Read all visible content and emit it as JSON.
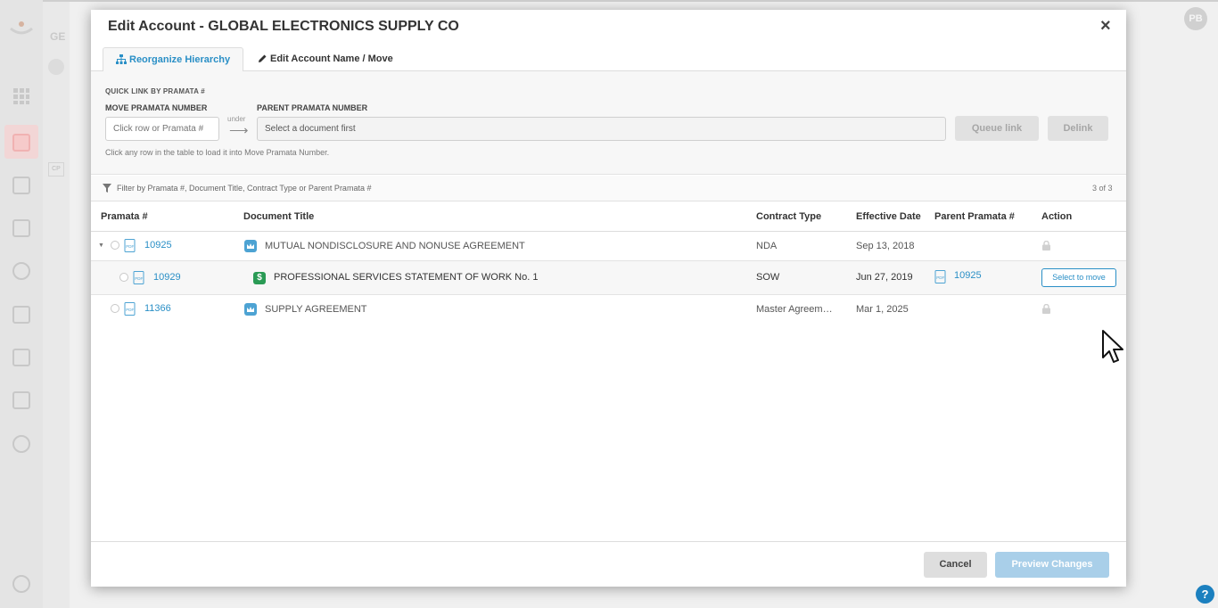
{
  "background": {
    "section_code": "GE",
    "cp_label": "CP",
    "avatar_initials": "PB",
    "help_label": "?"
  },
  "modal": {
    "title": "Edit Account - GLOBAL ELECTRONICS SUPPLY CO",
    "tabs": [
      {
        "label": "Reorganize Hierarchy",
        "icon": "sitemap-icon",
        "active": true
      },
      {
        "label": "Edit Account Name / Move",
        "icon": "pencil-icon",
        "active": false
      }
    ],
    "quick_link": {
      "title": "QUICK LINK BY PRAMATA #",
      "move_label": "MOVE PRAMATA NUMBER",
      "move_placeholder": "Click row or Pramata #",
      "under_label": "under",
      "parent_label": "PARENT PRAMATA NUMBER",
      "parent_placeholder": "Select a document first",
      "queue_label": "Queue link",
      "delink_label": "Delink",
      "hint": "Click any row in the table to load it into Move Pramata Number."
    },
    "filter": {
      "placeholder": "Filter by Pramata #, Document Title, Contract Type or Parent Pramata #",
      "count": "3 of 3"
    },
    "table": {
      "headers": [
        "Pramata #",
        "Document Title",
        "Contract Type",
        "Effective Date",
        "Parent Pramata #",
        "Action"
      ],
      "rows": [
        {
          "pramata": "10925",
          "title": "MUTUAL NONDISCLOSURE AND NONUSE AGREEMENT",
          "type_icon": "crown-icon",
          "contract_type": "NDA",
          "effective_date": "Sep 13, 2018",
          "parent": "",
          "action": "lock"
        },
        {
          "pramata": "10929",
          "title": "PROFESSIONAL SERVICES STATEMENT OF WORK No. 1",
          "type_icon": "dollar-icon",
          "contract_type": "SOW",
          "effective_date": "Jun 27, 2019",
          "parent": "10925",
          "action": "Select to move"
        },
        {
          "pramata": "11366",
          "title": "SUPPLY AGREEMENT",
          "type_icon": "crown-icon",
          "contract_type": "Master Agreem…",
          "effective_date": "Mar 1, 2025",
          "parent": "",
          "action": "lock"
        }
      ]
    },
    "footer": {
      "cancel_label": "Cancel",
      "preview_label": "Preview Changes"
    }
  },
  "colors": {
    "accent": "#2a8fc6",
    "preview_disabled": "#a9cfe9",
    "dollar_badge": "#2a9b55",
    "crown_badge": "#4da3d3"
  }
}
